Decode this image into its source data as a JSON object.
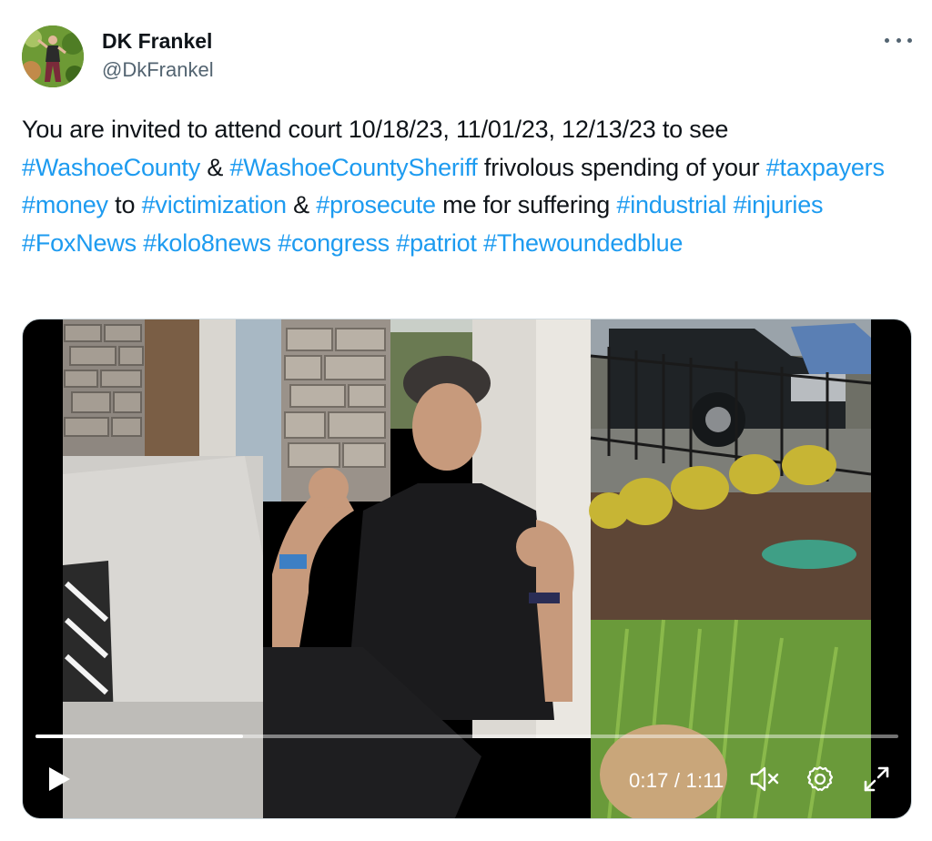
{
  "author": {
    "display_name": "DK Frankel",
    "handle": "@DkFrankel",
    "avatar_icon": "profile-photo"
  },
  "more_icon": "more-horizontal-icon",
  "tweet": {
    "segments": [
      {
        "type": "text",
        "value": "You are invited to attend court 10/18/23, 11/01/23, 12/13/23 to see "
      },
      {
        "type": "hashtag",
        "value": "#WashoeCounty"
      },
      {
        "type": "text",
        "value": " & "
      },
      {
        "type": "hashtag",
        "value": "#WashoeCountySheriff"
      },
      {
        "type": "text",
        "value": " frivolous spending of your "
      },
      {
        "type": "hashtag",
        "value": "#taxpayers"
      },
      {
        "type": "text",
        "value": " "
      },
      {
        "type": "hashtag",
        "value": "#money"
      },
      {
        "type": "text",
        "value": " to "
      },
      {
        "type": "hashtag",
        "value": "#victimization"
      },
      {
        "type": "text",
        "value": " & "
      },
      {
        "type": "hashtag",
        "value": "#prosecute"
      },
      {
        "type": "text",
        "value": " me for suffering "
      },
      {
        "type": "hashtag",
        "value": "#industrial"
      },
      {
        "type": "text",
        "value": " "
      },
      {
        "type": "hashtag",
        "value": "#injuries"
      },
      {
        "type": "text",
        "value": " "
      },
      {
        "type": "hashtag",
        "value": "#FoxNews"
      },
      {
        "type": "text",
        "value": " "
      },
      {
        "type": "hashtag",
        "value": "#kolo8news"
      },
      {
        "type": "text",
        "value": " "
      },
      {
        "type": "hashtag",
        "value": "#congress"
      },
      {
        "type": "text",
        "value": " "
      },
      {
        "type": "hashtag",
        "value": "#patriot"
      },
      {
        "type": "text",
        "value": " "
      },
      {
        "type": "hashtag",
        "value": "#Thewoundedblue"
      }
    ]
  },
  "video": {
    "current_time": "0:17",
    "duration": "1:11",
    "time_label": "0:17 / 1:11",
    "progress_fraction": 0.24,
    "play_icon": "play-icon",
    "mute_icon": "muted-speaker-icon",
    "settings_icon": "gear-icon",
    "fullscreen_icon": "expand-icon"
  },
  "colors": {
    "hashtag": "#1d9bf0",
    "secondary_text": "#536471",
    "primary_text": "#0f1419"
  }
}
